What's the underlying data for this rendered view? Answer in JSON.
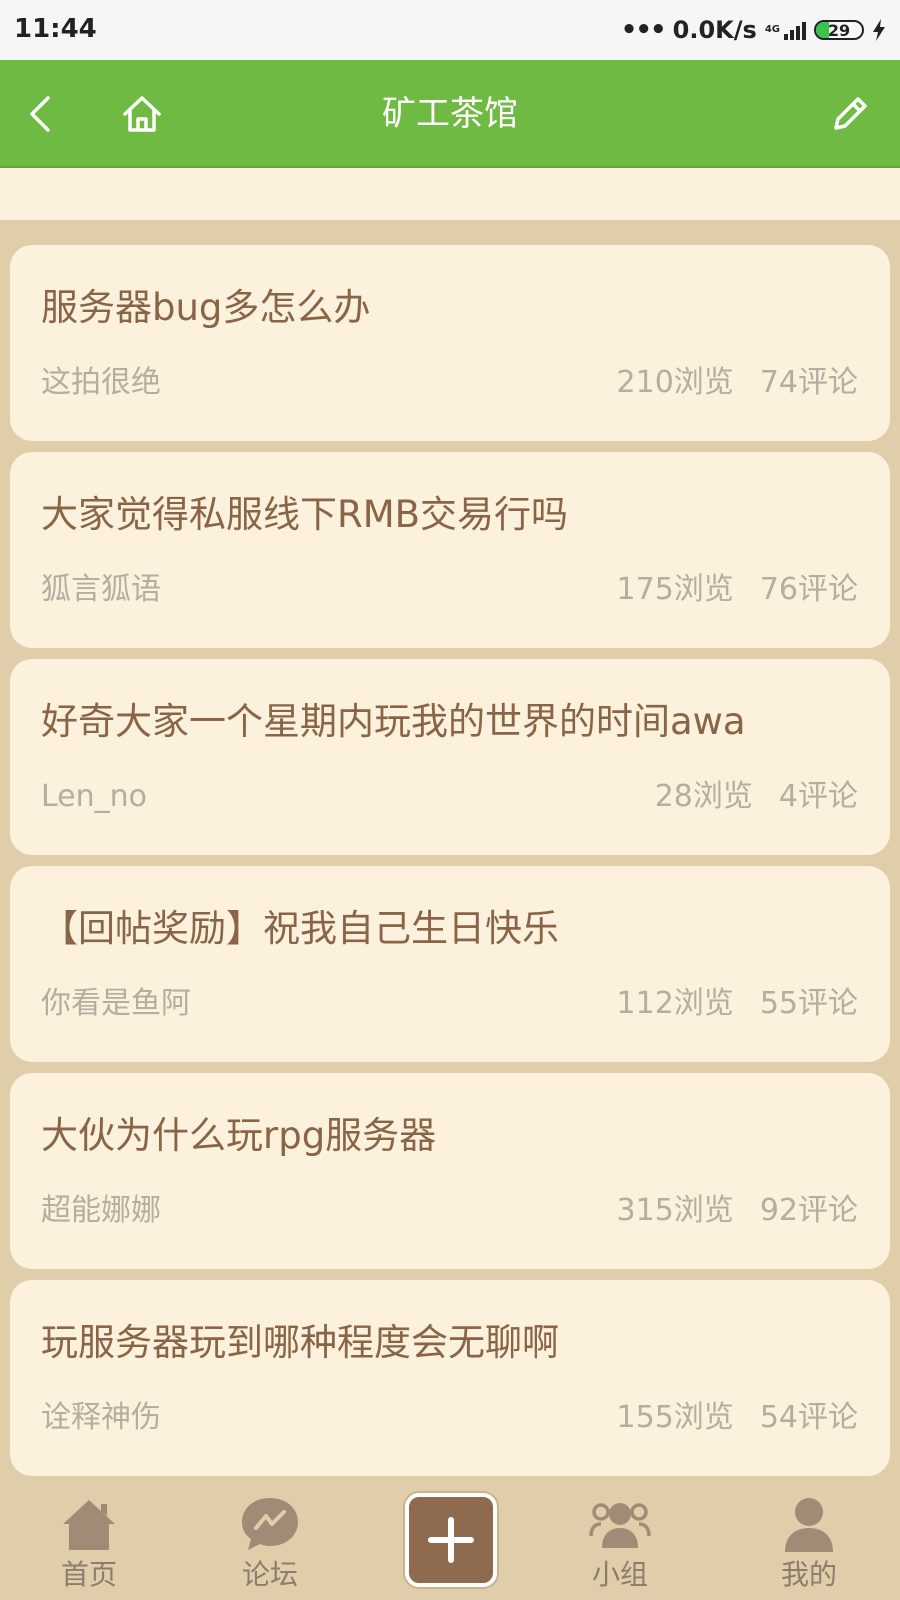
{
  "status_bar": {
    "time": "11:44",
    "dots": "•••",
    "speed": "0.0K/s",
    "network": "4G",
    "battery": "29",
    "battery_level": 0.29,
    "battery_color": "#3bc24a"
  },
  "header": {
    "title": "矿工茶馆",
    "background": "#6fba42",
    "back_icon": "chevron-left-icon",
    "home_icon": "home-icon",
    "edit_icon": "pencil-icon"
  },
  "posts": [
    {
      "title": "服务器bug多怎么办",
      "author": "这拍很绝",
      "views": "210浏览",
      "comments": "74评论"
    },
    {
      "title": "大家觉得私服线下RMB交易行吗",
      "author": "狐言狐语",
      "views": "175浏览",
      "comments": "76评论"
    },
    {
      "title": "好奇大家一个星期内玩我的世界的时间awa",
      "author": "Len_no",
      "views": "28浏览",
      "comments": "4评论"
    },
    {
      "title": "【回帖奖励】祝我自己生日快乐",
      "author": "你看是鱼阿",
      "views": "112浏览",
      "comments": "55评论"
    },
    {
      "title": "大伙为什么玩rpg服务器",
      "author": "超能娜娜",
      "views": "315浏览",
      "comments": "92评论"
    },
    {
      "title": "玩服务器玩到哪种程度会无聊啊",
      "author": "诠释神伤",
      "views": "155浏览",
      "comments": "54评论"
    }
  ],
  "bottom_nav": {
    "home": "首页",
    "forum": "论坛",
    "groups": "小组",
    "mine": "我的",
    "post_icon": "plus-icon"
  },
  "colors": {
    "title_text": "#8a6447",
    "meta_text": "#b6aca1",
    "card_bg": "#fbf1dc",
    "page_bg": "#e0cda9",
    "nav_icon": "#a08b76"
  }
}
